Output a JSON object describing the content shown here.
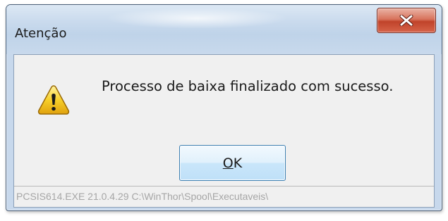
{
  "dialog": {
    "title": "Atenção",
    "close_icon": "close-x-icon",
    "message_icon": "warning-triangle-icon",
    "message": "Processo de baixa finalizado com sucesso.",
    "ok_button": {
      "accelerator": "O",
      "rest": "K"
    },
    "status_text": "PCSIS614.EXE 21.0.4.29 C:\\WinThor\\Spool\\Executaveis\\",
    "colors": {
      "titlebar": "#c9daed",
      "close_button": "#c0432a",
      "client_background": "#f0f0f0",
      "ok_button_border": "#3c7fb1",
      "warning_icon": "#f2c21b"
    }
  }
}
